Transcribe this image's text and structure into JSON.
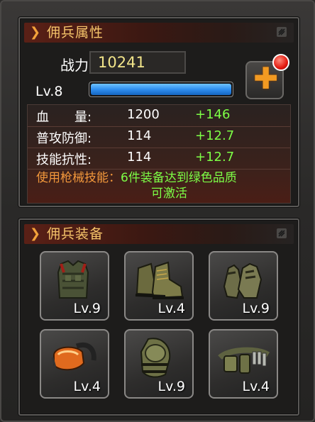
{
  "attr_panel": {
    "title": "佣兵属性",
    "power_label": "战力",
    "power_value": "10241",
    "level_label": "Lv.8",
    "level_progress": 1.0,
    "stats": [
      {
        "label": "血　　量:",
        "value": "1200",
        "bonus": "+146"
      },
      {
        "label": "普攻防御:",
        "value": "114",
        "bonus": "+12.7"
      },
      {
        "label": "技能抗性:",
        "value": "114",
        "bonus": "+12.7"
      }
    ],
    "skill_label": "使用枪械技能：",
    "skill_text_1": "6件装备达到绿色品质",
    "skill_text_2": "可激活"
  },
  "equip_panel": {
    "title": "佣兵装备",
    "items": [
      {
        "icon": "vest-icon",
        "level": "Lv.9"
      },
      {
        "icon": "boots-icon",
        "level": "Lv.4"
      },
      {
        "icon": "gloves-icon",
        "level": "Lv.9"
      },
      {
        "icon": "goggles-icon",
        "level": "Lv.4"
      },
      {
        "icon": "kneepad-icon",
        "level": "Lv.9"
      },
      {
        "icon": "belt-icon",
        "level": "Lv.4"
      }
    ]
  },
  "colors": {
    "title": "#f6c46a",
    "bonus": "#7dff46",
    "skill_label": "#f1973b",
    "power": "#f2e58a",
    "level_bar": "#2f8ff0"
  }
}
